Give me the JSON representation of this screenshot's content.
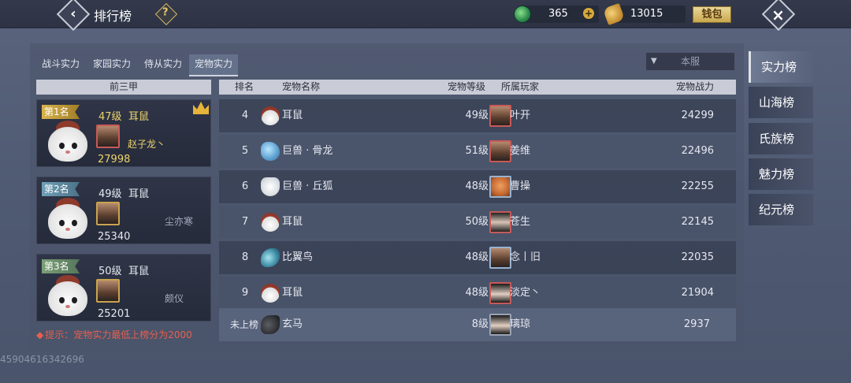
{
  "header": {
    "title": "排行榜",
    "help_label": "?",
    "jade": "365",
    "gold": "13015",
    "wallet_label": "钱包",
    "plus_label": "+"
  },
  "tabs": [
    "战斗实力",
    "家园实力",
    "侍从实力",
    "宠物实力"
  ],
  "server_filter": {
    "value": "本服"
  },
  "top_three": {
    "header": "前三甲",
    "entries": [
      {
        "rank_label": "第1名",
        "level": "47级",
        "pet": "耳鼠",
        "player": "赵子龙丶",
        "power": "27998"
      },
      {
        "rank_label": "第2名",
        "level": "49级",
        "pet": "耳鼠",
        "player": "尘亦寒",
        "power": "25340"
      },
      {
        "rank_label": "第3名",
        "level": "50级",
        "pet": "耳鼠",
        "player": "颇仪",
        "power": "25201"
      }
    ]
  },
  "table": {
    "headers": {
      "rank": "排名",
      "pet_name": "宠物名称",
      "pet_level": "宠物等级",
      "owner": "所属玩家",
      "power": "宠物战力"
    },
    "rows": [
      {
        "rank": "4",
        "pet_icon": "erbao-icon",
        "pet": "耳鼠",
        "level": "49级",
        "player": "叶开",
        "power": "24299"
      },
      {
        "rank": "5",
        "pet_icon": "bone-dragon-icon",
        "pet": "巨兽 · 骨龙",
        "level": "51级",
        "player": "姜维",
        "power": "22496"
      },
      {
        "rank": "6",
        "pet_icon": "hill-fox-icon",
        "pet": "巨兽 · 丘狐",
        "level": "48级",
        "player": "曹操",
        "power": "22255"
      },
      {
        "rank": "7",
        "pet_icon": "erbao-icon",
        "pet": "耳鼠",
        "level": "50级",
        "player": "苍生",
        "power": "22145"
      },
      {
        "rank": "8",
        "pet_icon": "biyi-bird-icon",
        "pet": "比翼鸟",
        "level": "48级",
        "player": "念丨旧",
        "power": "22035"
      },
      {
        "rank": "9",
        "pet_icon": "erbao-icon",
        "pet": "耳鼠",
        "level": "48级",
        "player": "淡定丶",
        "power": "21904"
      }
    ],
    "self_row": {
      "rank": "未上榜",
      "pet_icon": "black-horse-icon",
      "pet": "玄马",
      "level": "8级",
      "player": "璃琼",
      "power": "2937"
    }
  },
  "tip": "提示：宠物实力最低上榜分为2000",
  "tip_icon": "diamond-bullet-icon",
  "bottom_id": "4590461634269​6",
  "side_tabs": [
    "实力榜",
    "山海榜",
    "氏族榜",
    "魅力榜",
    "纪元榜"
  ]
}
